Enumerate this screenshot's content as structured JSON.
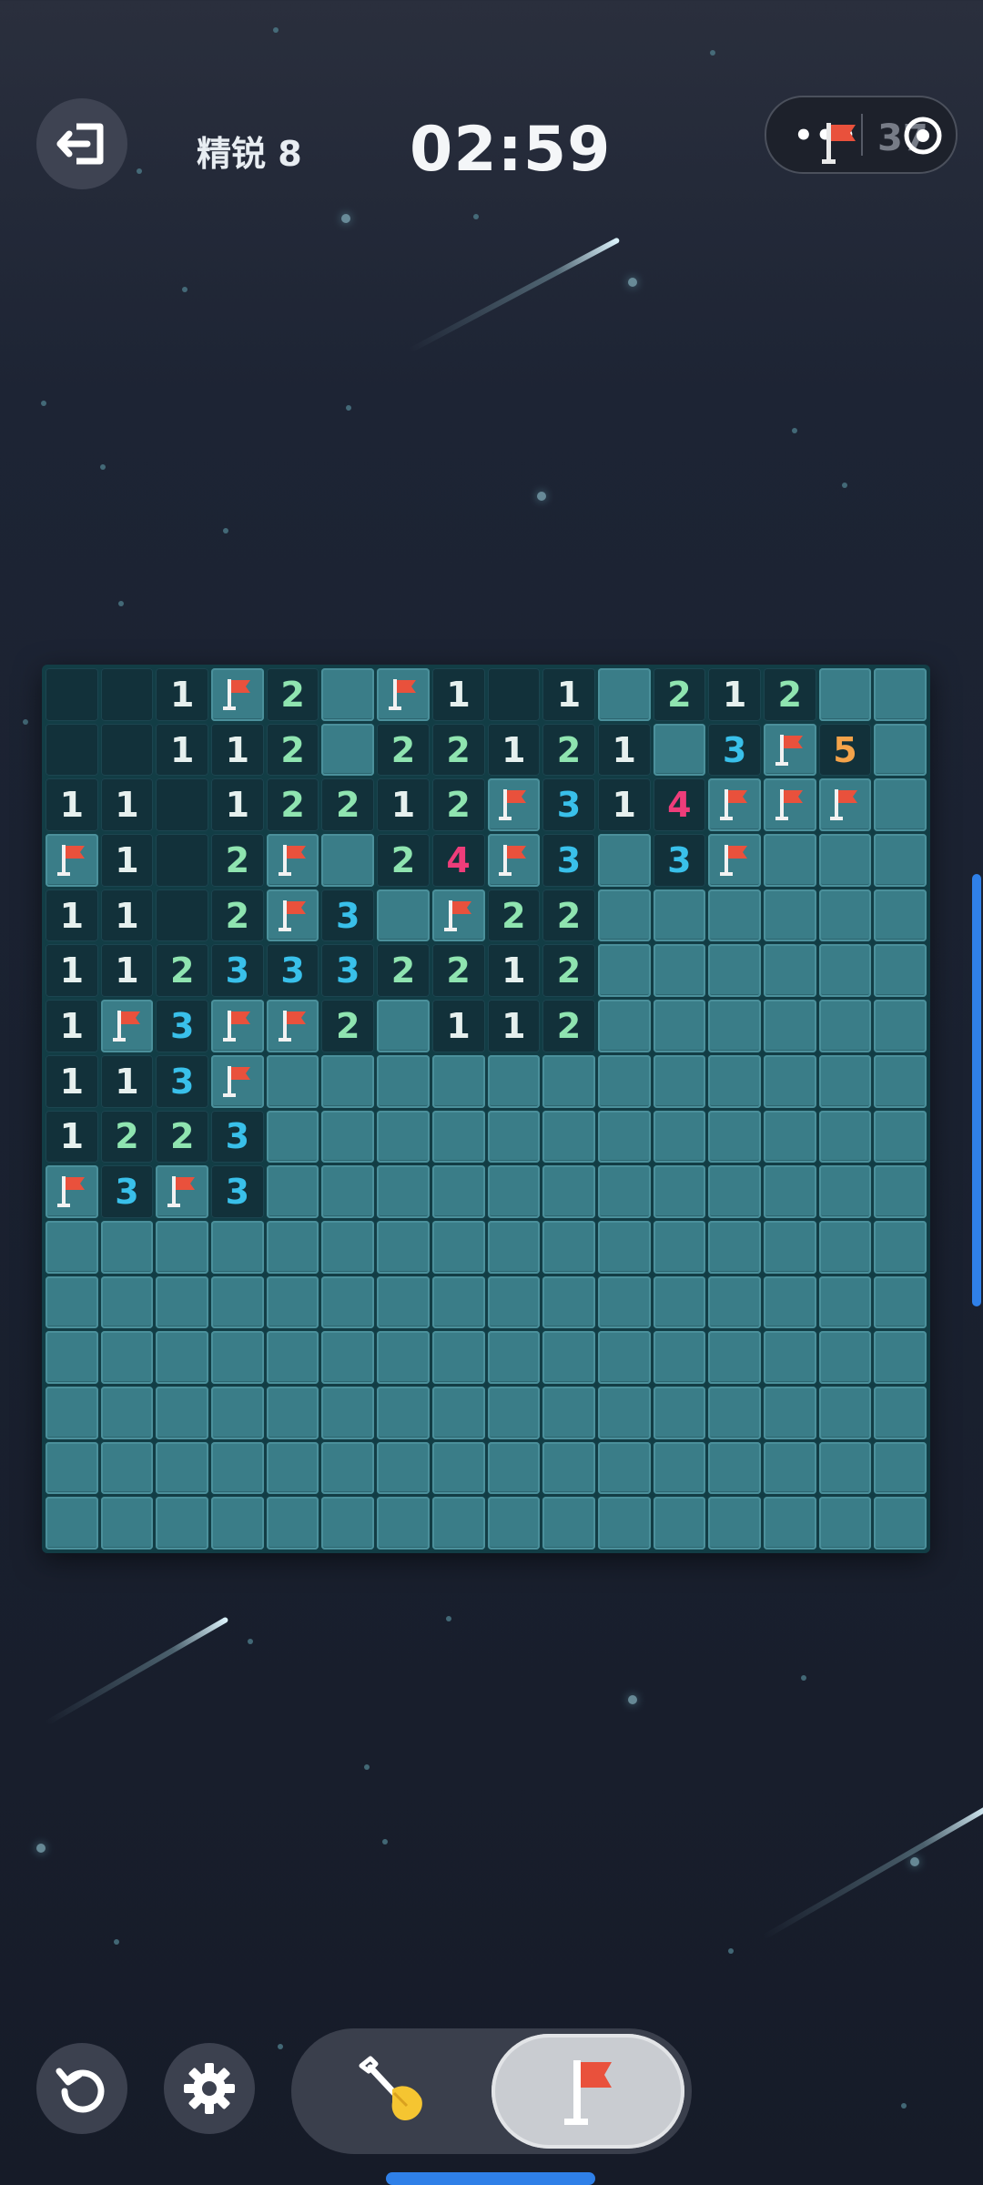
{
  "header": {
    "level_label": "精锐 8",
    "timer": "02:59",
    "menu_dots": "•••",
    "flags_remaining": "37"
  },
  "colors": {
    "number_1": "#e6f0ee",
    "number_2": "#8fe4b0",
    "number_3": "#39c0ea",
    "number_4": "#ee3d7a",
    "number_5": "#f4a34a",
    "flag": "#e9513c",
    "covered_cell": "#3a7d88",
    "open_cell": "#12313a",
    "accent_blue": "#2f80e8"
  },
  "board": {
    "size": 16,
    "legend": {
      "#": "covered",
      "F": "flagged",
      ".": "open-empty",
      "1-8": "open-number"
    },
    "rows": [
      "..1F2#F1.1#212##",
      "..112#22121#3F5#",
      "11.12212F314FFF#",
      "F1.2F#24F3#3F###",
      "11.2F3#F22######",
      "1123332212######",
      "1F3FF2#112######",
      "113F############",
      "1223############",
      "F3F3############",
      "################",
      "################",
      "################",
      "################",
      "################",
      "################"
    ]
  },
  "controls": {
    "restart": "restart-icon",
    "settings": "gear-icon",
    "modes": [
      {
        "name": "dig",
        "icon": "shovel-icon",
        "selected": false
      },
      {
        "name": "flag",
        "icon": "flag-icon",
        "selected": true
      }
    ]
  }
}
